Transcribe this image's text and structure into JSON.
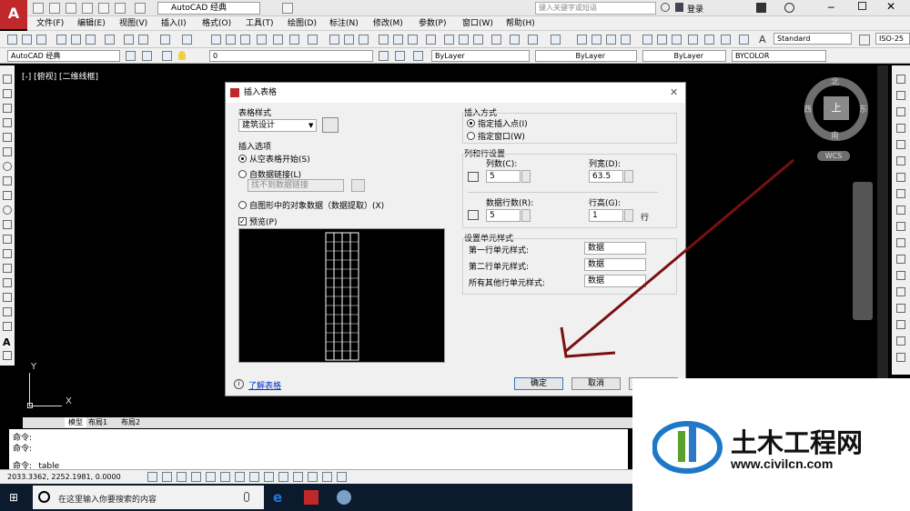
{
  "app": {
    "logo_letter": "A",
    "workspace": "AutoCAD 经典",
    "search_placeholder": "键入关键字或短语",
    "login": "登录"
  },
  "menu": [
    "文件(F)",
    "编辑(E)",
    "视图(V)",
    "插入(I)",
    "格式(O)",
    "工具(T)",
    "绘图(D)",
    "标注(N)",
    "修改(M)",
    "参数(P)",
    "窗口(W)",
    "帮助(H)"
  ],
  "toolbar2": {
    "workspace_combo": "AutoCAD 经典",
    "layer_value": "0",
    "bylayer1": "ByLayer",
    "bylayer2": "ByLayer",
    "bylayer3": "ByLayer",
    "bycolor": "BYCOLOR",
    "text_style": "Standard",
    "dim_style": "ISO-25"
  },
  "canvas": {
    "viewport_label": "[-] [俯视] [二维线框]",
    "compass": {
      "north": "北",
      "south": "南",
      "east": "东",
      "west": "西",
      "center": "上",
      "wcs": "WCS"
    },
    "ucs": {
      "y": "Y",
      "x": "X"
    }
  },
  "dialog": {
    "title": "插入表格",
    "table_style_label": "表格样式",
    "table_style_value": "建筑设计",
    "insert_options_label": "插入选项",
    "opt_empty": "从空表格开始(S)",
    "opt_datalink": "自数据链接(L)",
    "datalink_value": "找不到数据链接",
    "opt_objects": "自图形中的对象数据（数据提取）(X)",
    "preview_label": "预览(P)",
    "insert_method_label": "插入方式",
    "method_point": "指定插入点(I)",
    "method_window": "指定窗口(W)",
    "row_col_label": "列和行设置",
    "columns_label": "列数(C):",
    "columns_value": "5",
    "col_width_label": "列宽(D):",
    "col_width_value": "63.5",
    "data_rows_label": "数据行数(R):",
    "data_rows_value": "5",
    "row_height_label": "行高(G):",
    "row_height_value": "1",
    "row_unit": "行",
    "cell_style_label": "设置单元样式",
    "first_row_label": "第一行单元样式:",
    "first_row_value": "数据",
    "second_row_label": "第二行单元样式:",
    "second_row_value": "数据",
    "other_rows_label": "所有其他行单元样式:",
    "other_rows_value": "数据",
    "learn_link": "了解表格",
    "ok": "确定",
    "cancel": "取消"
  },
  "tabs": [
    "模型",
    "布局1",
    "布局2"
  ],
  "command": {
    "line1": "命令:",
    "line2": "命令:",
    "line3": "命令:  _table"
  },
  "status": {
    "coords": "2033.3362,   2252.1981, 0.0000"
  },
  "taskbar": {
    "search": "在这里输入你要搜索的内容"
  },
  "watermark": {
    "name": "土木工程网",
    "url": "www.civilcn.com"
  },
  "colors": {
    "annotation_arrow": "#7a1010",
    "logo_red": "#c0282b"
  }
}
